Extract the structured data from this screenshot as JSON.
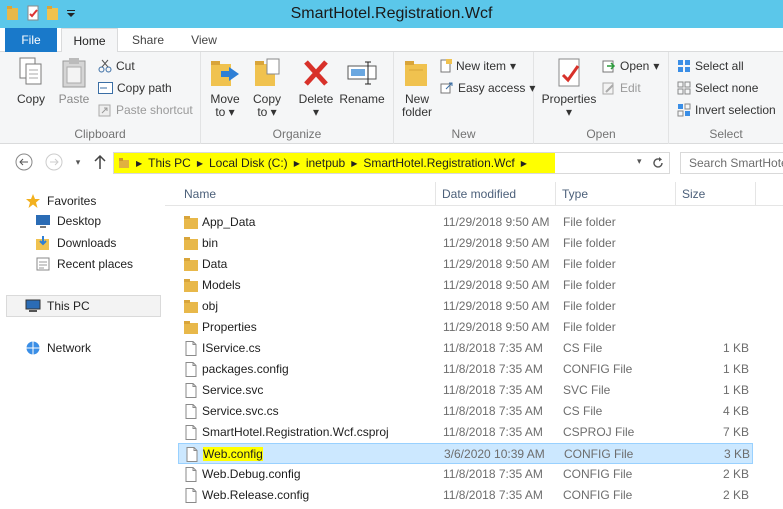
{
  "window": {
    "title": "SmartHotel.Registration.Wcf"
  },
  "tabs": [
    "File",
    "Home",
    "Share",
    "View"
  ],
  "ribbon": {
    "clipboard": {
      "label": "Clipboard",
      "copy": "Copy",
      "paste": "Paste",
      "cut": "Cut",
      "copy_path": "Copy path",
      "paste_shortcut": "Paste shortcut"
    },
    "organize": {
      "label": "Organize",
      "move_to": "Move",
      "move_to2": "to",
      "copy_to": "Copy",
      "copy_to2": "to",
      "delete": "Delete",
      "rename": "Rename"
    },
    "new": {
      "label": "New",
      "new_folder": "New",
      "new_folder2": "folder",
      "new_item": "New item",
      "easy_access": "Easy access"
    },
    "open": {
      "label": "Open",
      "properties": "Properties",
      "open": "Open",
      "edit": "Edit"
    },
    "select": {
      "label": "Select",
      "select_all": "Select all",
      "select_none": "Select none",
      "invert_selection": "Invert selection"
    }
  },
  "address": {
    "crumbs": [
      "This PC",
      "Local Disk (C:)",
      "inetpub",
      "SmartHotel.Registration.Wcf"
    ],
    "search_placeholder": "Search SmartHotel..."
  },
  "nav": {
    "favorites": "Favorites",
    "desktop": "Desktop",
    "downloads": "Downloads",
    "recent": "Recent places",
    "thispc": "This PC",
    "network": "Network"
  },
  "columns": {
    "name": "Name",
    "date": "Date modified",
    "type": "Type",
    "size": "Size"
  },
  "files": [
    {
      "name": "App_Data",
      "date": "11/29/2018 9:50 AM",
      "type": "File folder",
      "size": "",
      "kind": "folder"
    },
    {
      "name": "bin",
      "date": "11/29/2018 9:50 AM",
      "type": "File folder",
      "size": "",
      "kind": "folder"
    },
    {
      "name": "Data",
      "date": "11/29/2018 9:50 AM",
      "type": "File folder",
      "size": "",
      "kind": "folder"
    },
    {
      "name": "Models",
      "date": "11/29/2018 9:50 AM",
      "type": "File folder",
      "size": "",
      "kind": "folder"
    },
    {
      "name": "obj",
      "date": "11/29/2018 9:50 AM",
      "type": "File folder",
      "size": "",
      "kind": "folder"
    },
    {
      "name": "Properties",
      "date": "11/29/2018 9:50 AM",
      "type": "File folder",
      "size": "",
      "kind": "folder"
    },
    {
      "name": "IService.cs",
      "date": "11/8/2018 7:35 AM",
      "type": "CS File",
      "size": "1 KB",
      "kind": "file"
    },
    {
      "name": "packages.config",
      "date": "11/8/2018 7:35 AM",
      "type": "CONFIG File",
      "size": "1 KB",
      "kind": "file"
    },
    {
      "name": "Service.svc",
      "date": "11/8/2018 7:35 AM",
      "type": "SVC File",
      "size": "1 KB",
      "kind": "file"
    },
    {
      "name": "Service.svc.cs",
      "date": "11/8/2018 7:35 AM",
      "type": "CS File",
      "size": "4 KB",
      "kind": "file"
    },
    {
      "name": "SmartHotel.Registration.Wcf.csproj",
      "date": "11/8/2018 7:35 AM",
      "type": "CSPROJ File",
      "size": "7 KB",
      "kind": "file"
    },
    {
      "name": "Web.config",
      "date": "3/6/2020 10:39 AM",
      "type": "CONFIG File",
      "size": "3 KB",
      "kind": "file",
      "selected": true
    },
    {
      "name": "Web.Debug.config",
      "date": "11/8/2018 7:35 AM",
      "type": "CONFIG File",
      "size": "2 KB",
      "kind": "file"
    },
    {
      "name": "Web.Release.config",
      "date": "11/8/2018 7:35 AM",
      "type": "CONFIG File",
      "size": "2 KB",
      "kind": "file"
    }
  ]
}
